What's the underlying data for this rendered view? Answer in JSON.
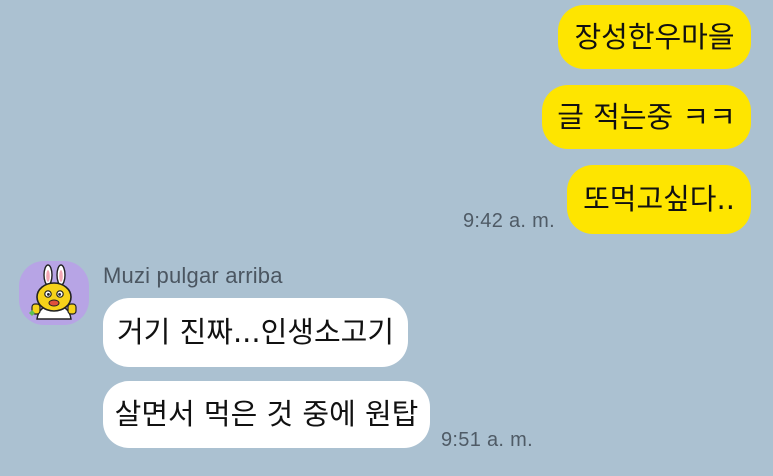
{
  "outgoing": {
    "messages": [
      {
        "text": "장성한우마을"
      },
      {
        "text": "글 적는중 ㅋㅋ"
      },
      {
        "text": "또먹고싶다.."
      }
    ],
    "time": "9:42 a. m."
  },
  "incoming": {
    "sender": "Muzi pulgar arriba",
    "avatar_icon": "muzi-thumbs-up-avatar-icon",
    "messages": [
      {
        "text": "거기 진짜...인생소고기"
      },
      {
        "text": "살면서 먹은 것 중에 원탑"
      }
    ],
    "time": "9:51 a. m."
  },
  "colors": {
    "background": "#abc1d1",
    "outgoing_bubble": "#fee500",
    "incoming_bubble": "#ffffff",
    "timestamp": "#4f5b66"
  }
}
